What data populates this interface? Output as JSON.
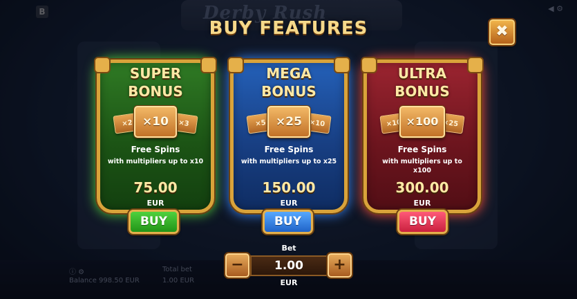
{
  "header": {
    "title": "BUY FEATURES",
    "close_glyph": "✖"
  },
  "background": {
    "game_title": "Derby Rush",
    "logo_letter": "B",
    "balance": "Balance 998.50 EUR",
    "total_bet_label": "Total bet",
    "total_bet_value": "1.00 EUR"
  },
  "features": [
    {
      "name": "SUPER\nBONUS",
      "multiplier": "×10",
      "side_left": "×2",
      "side_right": "×3",
      "spins_title": "Free Spins",
      "description": "with multipliers up to x10",
      "price": "75.00",
      "currency": "EUR",
      "buy_label": "BUY",
      "accent": "#2f7a24"
    },
    {
      "name": "MEGA\nBONUS",
      "multiplier": "×25",
      "side_left": "×5",
      "side_right": "×10",
      "spins_title": "Free Spins",
      "description": "with multipliers up to x25",
      "price": "150.00",
      "currency": "EUR",
      "buy_label": "BUY",
      "accent": "#2460b8"
    },
    {
      "name": "ULTRA\nBONUS",
      "multiplier": "×100",
      "side_left": "×10",
      "side_right": "×25",
      "spins_title": "Free Spins",
      "description": "with multipliers up to x100",
      "price": "300.00",
      "currency": "EUR",
      "buy_label": "BUY",
      "accent": "#9b2430"
    }
  ],
  "bet": {
    "label": "Bet",
    "value": "1.00",
    "currency": "EUR",
    "minus": "−",
    "plus": "+"
  },
  "colors": {
    "title_gold": "#f6d98a",
    "frame_gold": "#d9a33a"
  }
}
